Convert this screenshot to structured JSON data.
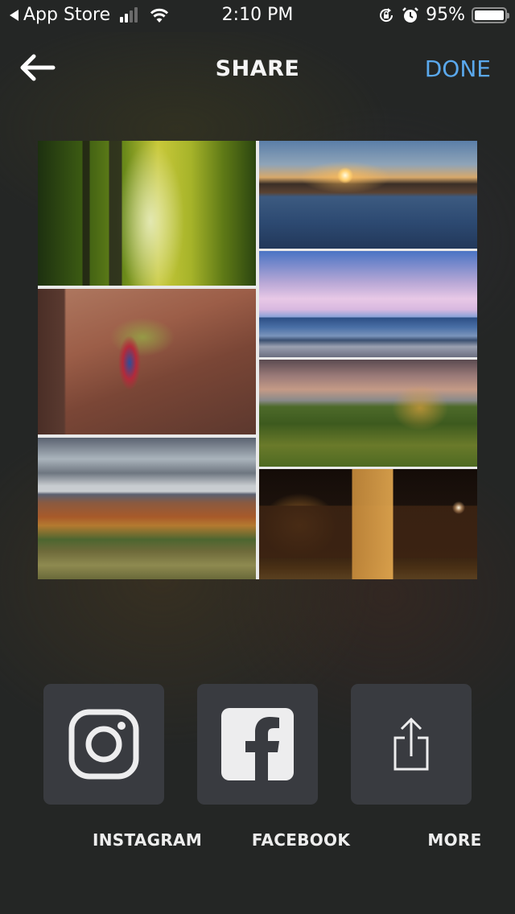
{
  "status_bar": {
    "back_app": "App Store",
    "time": "2:10 PM",
    "battery_percent": "95%",
    "signal_bars_active": 2,
    "signal_bars_total": 4,
    "icons": [
      "back-triangle-icon",
      "cellular-signal-icon",
      "wifi-icon",
      "orientation-lock-icon",
      "alarm-icon",
      "battery-icon"
    ]
  },
  "navbar": {
    "back_icon": "arrow-left-icon",
    "title": "SHARE",
    "done_label": "DONE",
    "done_color": "#5aa8ec"
  },
  "collage": {
    "photos": [
      {
        "name": "forest-photo",
        "description": "Sunlit redwood forest"
      },
      {
        "name": "sunset-lake-photo",
        "description": "Sunset over lake"
      },
      {
        "name": "blue-mountains-photo",
        "description": "Blue mountains under pink clouds"
      },
      {
        "name": "autumn-hills-photo",
        "description": "Autumn hillside at dusk"
      },
      {
        "name": "night-house-photo",
        "description": "House at night with lights"
      },
      {
        "name": "red-rocks-photo",
        "description": "Hiker among red rocks"
      },
      {
        "name": "cloudy-autumn-mountains-photo",
        "description": "Autumn mountains with clouds"
      }
    ]
  },
  "share_options": [
    {
      "label": "INSTAGRAM",
      "icon": "instagram-icon"
    },
    {
      "label": "FACEBOOK",
      "icon": "facebook-icon"
    },
    {
      "label": "MORE",
      "icon": "share-upload-icon"
    }
  ]
}
